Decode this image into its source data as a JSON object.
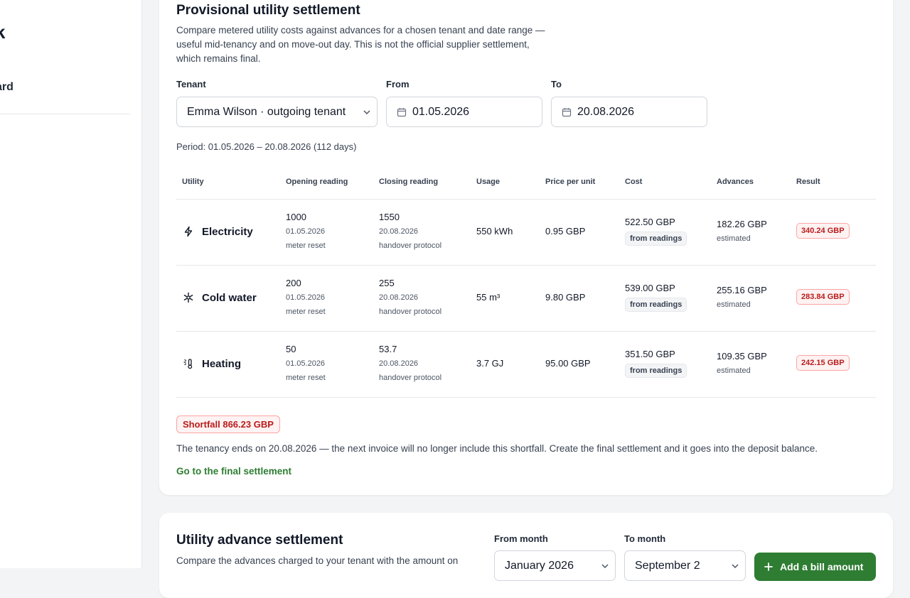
{
  "sidebar": {
    "logo_fragment": "k",
    "item_fragment": "ard"
  },
  "provisional": {
    "title": "Provisional utility settlement",
    "description": "Compare metered utility costs against advances for a chosen tenant and date range — useful mid-tenancy and on move-out day. This is not the official supplier settlement, which remains final.",
    "tenant_label": "Tenant",
    "tenant_value": "Emma Wilson · outgoing tenant",
    "from_label": "From",
    "from_value": "01.05.2026",
    "to_label": "To",
    "to_value": "20.08.2026",
    "period_text": "Period: 01.05.2026 – 20.08.2026 (112 days)",
    "columns": [
      "Utility",
      "Opening reading",
      "Closing reading",
      "Usage",
      "Price per unit",
      "Cost",
      "Advances",
      "Result"
    ],
    "rows": [
      {
        "icon": "lightning-icon",
        "utility": "Electricity",
        "opening": "1000",
        "opening_date": "01.05.2026",
        "opening_note": "meter reset",
        "closing": "1550",
        "closing_date": "20.08.2026",
        "closing_note": "handover protocol",
        "usage": "550 kWh",
        "price": "0.95 GBP",
        "cost": "522.50 GBP",
        "cost_source": "from readings",
        "advances": "182.26 GBP",
        "advances_note": "estimated",
        "result": "340.24 GBP"
      },
      {
        "icon": "snowflake-icon",
        "utility": "Cold water",
        "opening": "200",
        "opening_date": "01.05.2026",
        "opening_note": "meter reset",
        "closing": "255",
        "closing_date": "20.08.2026",
        "closing_note": "handover protocol",
        "usage": "55 m³",
        "price": "9.80 GBP",
        "cost": "539.00 GBP",
        "cost_source": "from readings",
        "advances": "255.16 GBP",
        "advances_note": "estimated",
        "result": "283.84 GBP"
      },
      {
        "icon": "thermometer-sun-icon",
        "utility": "Heating",
        "opening": "50",
        "opening_date": "01.05.2026",
        "opening_note": "meter reset",
        "closing": "53.7",
        "closing_date": "20.08.2026",
        "closing_note": "handover protocol",
        "usage": "3.7 GJ",
        "price": "95.00 GBP",
        "cost": "351.50 GBP",
        "cost_source": "from readings",
        "advances": "109.35 GBP",
        "advances_note": "estimated",
        "result": "242.15 GBP"
      }
    ],
    "shortfall": "Shortfall 866.23 GBP",
    "note": "The tenancy ends on 20.08.2026 — the next invoice will no longer include this shortfall. Create the final settlement and it goes into the deposit balance.",
    "link": "Go to the final settlement"
  },
  "advance": {
    "title": "Utility advance settlement",
    "description": "Compare the advances charged to your tenant with the amount on",
    "from_month_label": "From month",
    "from_month_value": "January 2026",
    "to_month_label": "To month",
    "to_month_value": "September 2",
    "add_button": "Add a bill amount"
  },
  "colors": {
    "accent_green": "#2e7d32",
    "danger_red": "#b91c1c"
  }
}
